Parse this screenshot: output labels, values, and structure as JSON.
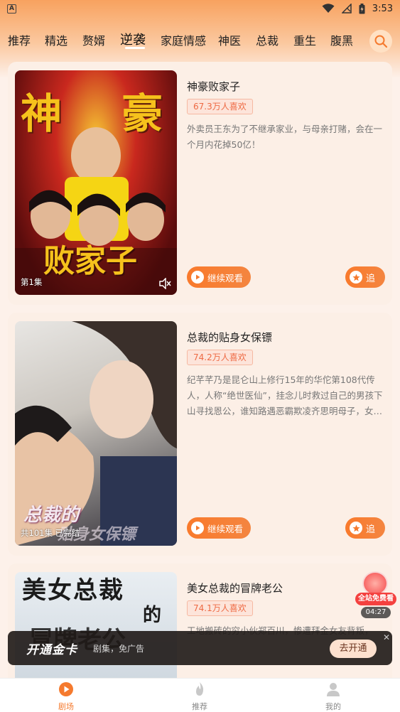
{
  "status_bar": {
    "time": "3:53",
    "app_letter": "A"
  },
  "tabs": [
    {
      "label": "推荐"
    },
    {
      "label": "精选"
    },
    {
      "label": "赘婿"
    },
    {
      "label": "逆袭",
      "active": true
    },
    {
      "label": "家庭情感"
    },
    {
      "label": "神医"
    },
    {
      "label": "总裁"
    },
    {
      "label": "重生"
    },
    {
      "label": "腹黑"
    }
  ],
  "cards": [
    {
      "title": "神豪败家子",
      "likes": "67.3万人喜欢",
      "desc": "外卖员王东为了不继承家业，与母亲打赌，会在一个月内花掉50亿！",
      "caption": "第1集",
      "continue_label": "继续观看",
      "follow_label": "追"
    },
    {
      "title": "总裁的贴身女保镖",
      "likes": "74.2万人喜欢",
      "desc": "纪芊芊乃是昆仑山上修行15年的华佗第108代传人，人称“绝世医仙”，挂念儿时救过自己的男孩下山寻找恩公，谁知路遇恶霸欺凌齐思明母子，女…",
      "caption": "共101集 已完结",
      "continue_label": "继续观看",
      "follow_label": "追"
    },
    {
      "title": "美女总裁的冒牌老公",
      "likes": "74.1万人喜欢",
      "desc": "工地搬砖的穷小伙郑百川，惨遭拜金女友背叛，绝…"
    }
  ],
  "vip_banner": {
    "logo": "开通金卡",
    "sub": "剧集，免广告",
    "button": "去开通",
    "close": "✕"
  },
  "float_widget": {
    "label": "全站免费看",
    "time": "04:27"
  },
  "bottom_nav": [
    {
      "label": "剧场",
      "active": true
    },
    {
      "label": "推荐"
    },
    {
      "label": "我的"
    }
  ],
  "colors": {
    "accent": "#f57a2e",
    "tag_text": "#ee6a44"
  }
}
